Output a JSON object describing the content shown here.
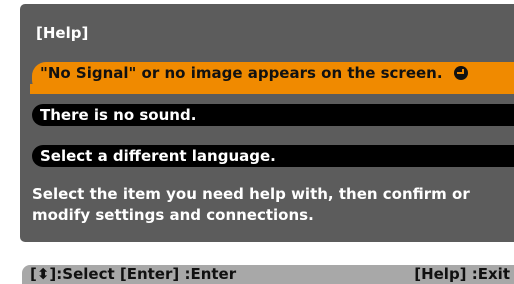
{
  "panel": {
    "title": "[Help]",
    "items": [
      {
        "label": "\"No Signal\" or no image appears on the screen.",
        "selected": true,
        "icon": "enter-icon"
      },
      {
        "label": "There is no sound.",
        "selected": false
      },
      {
        "label": "Select a different language.",
        "selected": false
      }
    ],
    "description": "Select the item you need help with, then confirm or modify settings and connections."
  },
  "footer": {
    "left": "[⬍]:Select  [Enter] :Enter",
    "right": "[Help] :Exit"
  },
  "colors": {
    "panel": "#5c5c5c",
    "selected": "#f08a00",
    "item": "#000000",
    "footer": "#a8a8a8"
  }
}
